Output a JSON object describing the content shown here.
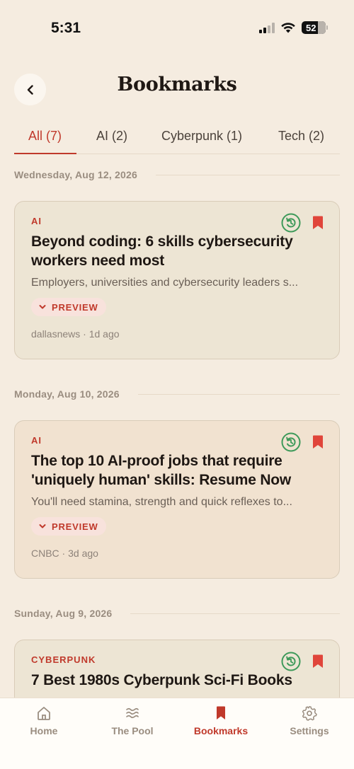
{
  "status": {
    "time": "5:31",
    "battery": "52"
  },
  "header": {
    "title": "Bookmarks"
  },
  "tabs": [
    {
      "label": "All (7)"
    },
    {
      "label": "AI (2)"
    },
    {
      "label": "Cyberpunk (1)"
    },
    {
      "label": "Tech (2)"
    }
  ],
  "groups": [
    {
      "date": "Wednesday, Aug 12, 2026",
      "article": {
        "topic": "AI",
        "title": "Beyond coding: 6 skills cybersecurity workers need most",
        "snippet": "Employers, universities and cybersecurity leaders s...",
        "preview_label": "PREVIEW",
        "meta": "dallasnews · 1d ago"
      }
    },
    {
      "date": "Monday, Aug 10, 2026",
      "article": {
        "topic": "AI",
        "title": "The top 10 AI-proof jobs that require 'uniquely human' skills: Resume Now",
        "snippet": "You'll need stamina, strength and quick reflexes to...",
        "preview_label": "PREVIEW",
        "meta": "CNBC · 3d ago"
      }
    },
    {
      "date": "Sunday, Aug 9, 2026",
      "article": {
        "topic": "CYBERPUNK",
        "title": "7 Best 1980s Cyberpunk Sci-Fi Books"
      }
    }
  ],
  "nav": [
    {
      "label": "Home",
      "icon": "home-icon"
    },
    {
      "label": "The Pool",
      "icon": "waves-icon"
    },
    {
      "label": "Bookmarks",
      "icon": "bookmark-icon"
    },
    {
      "label": "Settings",
      "icon": "gear-icon"
    }
  ],
  "colors": {
    "accent": "#c0392b",
    "background": "#f5ece0",
    "refresh": "#3e9a5a"
  }
}
